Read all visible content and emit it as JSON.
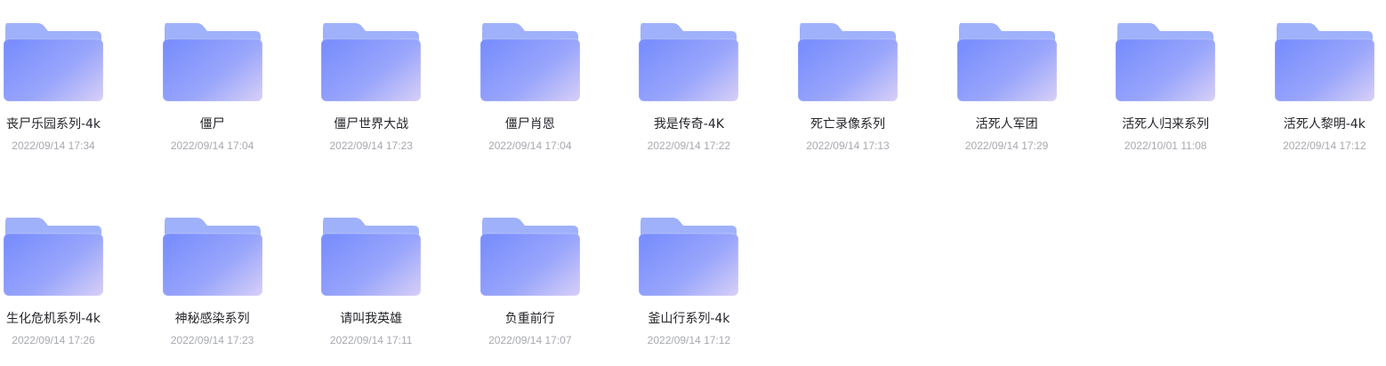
{
  "folder_icon": {
    "name": "folder-icon",
    "colors": {
      "back": "#9fb1fb",
      "front_start": "#7a8ffd",
      "front_end": "#d4cdf7"
    }
  },
  "folders": [
    {
      "name": "丧尸乐园系列-4k",
      "date": "2022/09/14 17:34"
    },
    {
      "name": "僵尸",
      "date": "2022/09/14 17:04"
    },
    {
      "name": "僵尸世界大战",
      "date": "2022/09/14 17:23"
    },
    {
      "name": "僵尸肖恩",
      "date": "2022/09/14 17:04"
    },
    {
      "name": "我是传奇-4K",
      "date": "2022/09/14 17:22"
    },
    {
      "name": "死亡录像系列",
      "date": "2022/09/14 17:13"
    },
    {
      "name": "活死人军团",
      "date": "2022/09/14 17:29"
    },
    {
      "name": "活死人归来系列",
      "date": "2022/10/01 11:08"
    },
    {
      "name": "活死人黎明-4k",
      "date": "2022/09/14 17:12"
    },
    {
      "name": "生化危机系列-4k",
      "date": "2022/09/14 17:26"
    },
    {
      "name": "神秘感染系列",
      "date": "2022/09/14 17:23"
    },
    {
      "name": "请叫我英雄",
      "date": "2022/09/14 17:11"
    },
    {
      "name": "负重前行",
      "date": "2022/09/14 17:07"
    },
    {
      "name": "釜山行系列-4k",
      "date": "2022/09/14 17:12"
    }
  ]
}
